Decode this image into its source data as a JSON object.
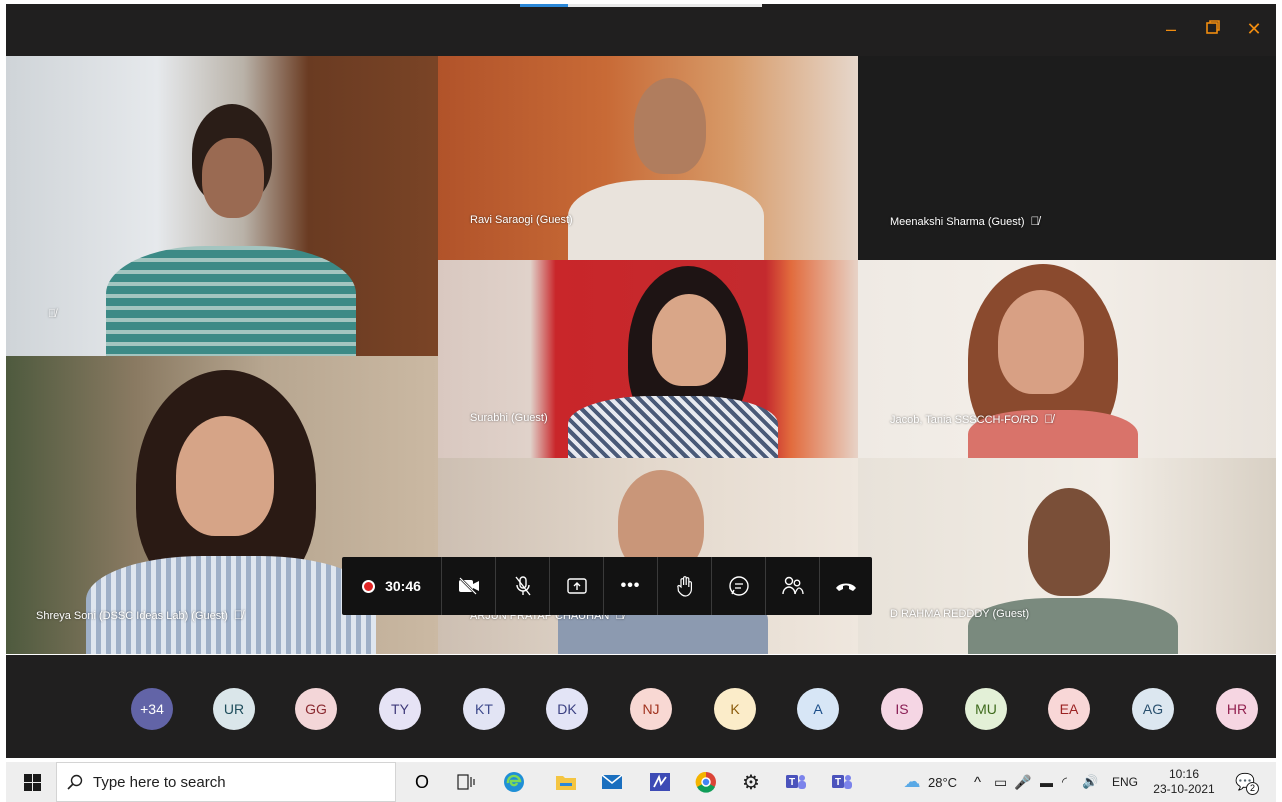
{
  "window": {
    "minimize_icon": "minimize-icon",
    "maximize_icon": "restore-icon",
    "close_icon": "close-icon",
    "accent_color": "#f08c10"
  },
  "participants": [
    {
      "name": "",
      "muted": true
    },
    {
      "name": "Ravi Saraogi (Guest)",
      "muted": false
    },
    {
      "name": "Meenakshi Sharma (Guest)",
      "muted": true
    },
    {
      "name": "Surabhi (Guest)",
      "muted": false
    },
    {
      "name": "Jacob, Tania SSSCCH-FO/RD",
      "muted": true
    },
    {
      "name": "Shreya Soni (DSSC Ideas Lab) (Guest)",
      "muted": true
    },
    {
      "name": "ARJUN PRATAP CHAUHAN",
      "muted": true
    },
    {
      "name": "D RAHMA REDDDY (Guest)",
      "muted": false
    }
  ],
  "call_controls": {
    "timer": "30:46",
    "record_color": "#e02424",
    "buttons": [
      "camera-off-icon",
      "mic-off-icon",
      "share-screen-icon",
      "more-icon",
      "raise-hand-icon",
      "chat-icon",
      "people-icon",
      "hang-up-icon"
    ]
  },
  "roster": [
    {
      "label": "+34",
      "bg": "#6264a7",
      "fg": "#ffffff"
    },
    {
      "label": "UR",
      "bg": "#dae6ea",
      "fg": "#1f4e5c"
    },
    {
      "label": "GG",
      "bg": "#f3d6d8",
      "fg": "#8a2a30"
    },
    {
      "label": "TY",
      "bg": "#e6e3f5",
      "fg": "#3f3a7a"
    },
    {
      "label": "KT",
      "bg": "#e2e4f4",
      "fg": "#3e4a8c"
    },
    {
      "label": "DK",
      "bg": "#e3e4f6",
      "fg": "#3b4082"
    },
    {
      "label": "NJ",
      "bg": "#f8d8d3",
      "fg": "#a1331f"
    },
    {
      "label": "K",
      "bg": "#fbecc9",
      "fg": "#8a5a0a"
    },
    {
      "label": "A",
      "bg": "#d7e6f6",
      "fg": "#1c4f8a"
    },
    {
      "label": "IS",
      "bg": "#f5d6e4",
      "fg": "#8a1f55"
    },
    {
      "label": "MU",
      "bg": "#e3f0d7",
      "fg": "#3e6a1c"
    },
    {
      "label": "EA",
      "bg": "#f8d7d7",
      "fg": "#9b2323"
    },
    {
      "label": "AG",
      "bg": "#dce7f0",
      "fg": "#29506e"
    },
    {
      "label": "HR",
      "bg": "#f6d6e2",
      "fg": "#92214f"
    }
  ],
  "taskbar": {
    "search_placeholder": "Type here to search",
    "weather": "28°C",
    "language": "ENG",
    "time": "10:16",
    "date": "23-10-2021",
    "notifications": "2"
  }
}
